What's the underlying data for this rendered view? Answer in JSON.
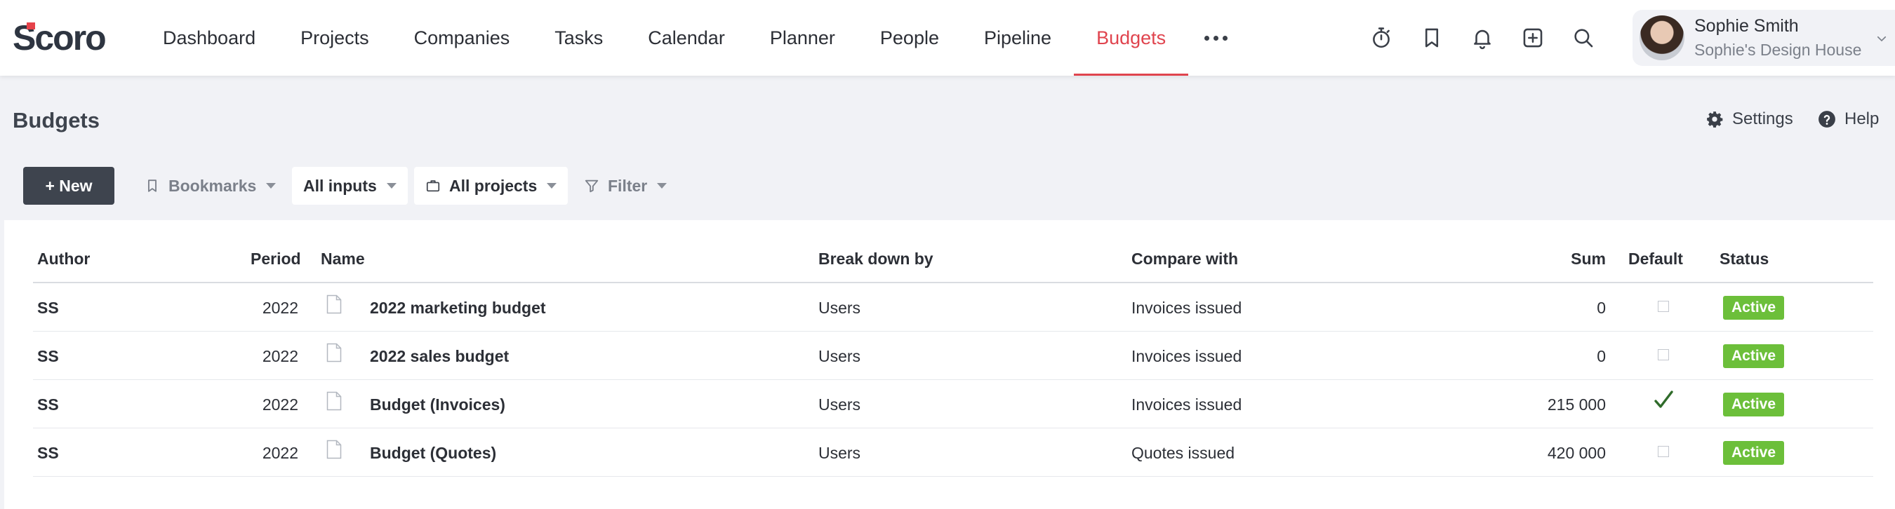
{
  "app": {
    "logo_text": "Scoro"
  },
  "nav": {
    "items": [
      {
        "label": "Dashboard"
      },
      {
        "label": "Projects"
      },
      {
        "label": "Companies"
      },
      {
        "label": "Tasks"
      },
      {
        "label": "Calendar"
      },
      {
        "label": "Planner"
      },
      {
        "label": "People"
      },
      {
        "label": "Pipeline"
      },
      {
        "label": "Budgets",
        "active": true
      }
    ],
    "more_icon": "more-horizontal-icon"
  },
  "top_icons": [
    "timer-icon",
    "bookmark-icon",
    "bell-icon",
    "add-icon",
    "search-icon"
  ],
  "user": {
    "name": "Sophie Smith",
    "company": "Sophie's Design House"
  },
  "page": {
    "title": "Budgets",
    "settings_label": "Settings",
    "help_label": "Help"
  },
  "toolbar": {
    "new_label": "+ New",
    "bookmarks_label": "Bookmarks",
    "inputs_label": "All inputs",
    "projects_label": "All projects",
    "filter_label": "Filter"
  },
  "table": {
    "columns": {
      "author": "Author",
      "period": "Period",
      "name": "Name",
      "break_down_by": "Break down by",
      "compare_with": "Compare with",
      "sum": "Sum",
      "default": "Default",
      "status": "Status"
    },
    "rows": [
      {
        "author": "SS",
        "period": "2022",
        "name": "2022 marketing budget",
        "break_down_by": "Users",
        "compare_with": "Invoices issued",
        "sum": "0",
        "default": false,
        "status": "Active"
      },
      {
        "author": "SS",
        "period": "2022",
        "name": "2022 sales budget",
        "break_down_by": "Users",
        "compare_with": "Invoices issued",
        "sum": "0",
        "default": false,
        "status": "Active"
      },
      {
        "author": "SS",
        "period": "2022",
        "name": "Budget (Invoices)",
        "break_down_by": "Users",
        "compare_with": "Invoices issued",
        "sum": "215 000",
        "default": true,
        "status": "Active"
      },
      {
        "author": "SS",
        "period": "2022",
        "name": "Budget (Quotes)",
        "break_down_by": "Users",
        "compare_with": "Quotes issued",
        "sum": "420 000",
        "default": false,
        "status": "Active"
      }
    ]
  },
  "colors": {
    "accent": "#e0444e",
    "status_active": "#6cbf3a",
    "primary_button": "#3e444e"
  }
}
